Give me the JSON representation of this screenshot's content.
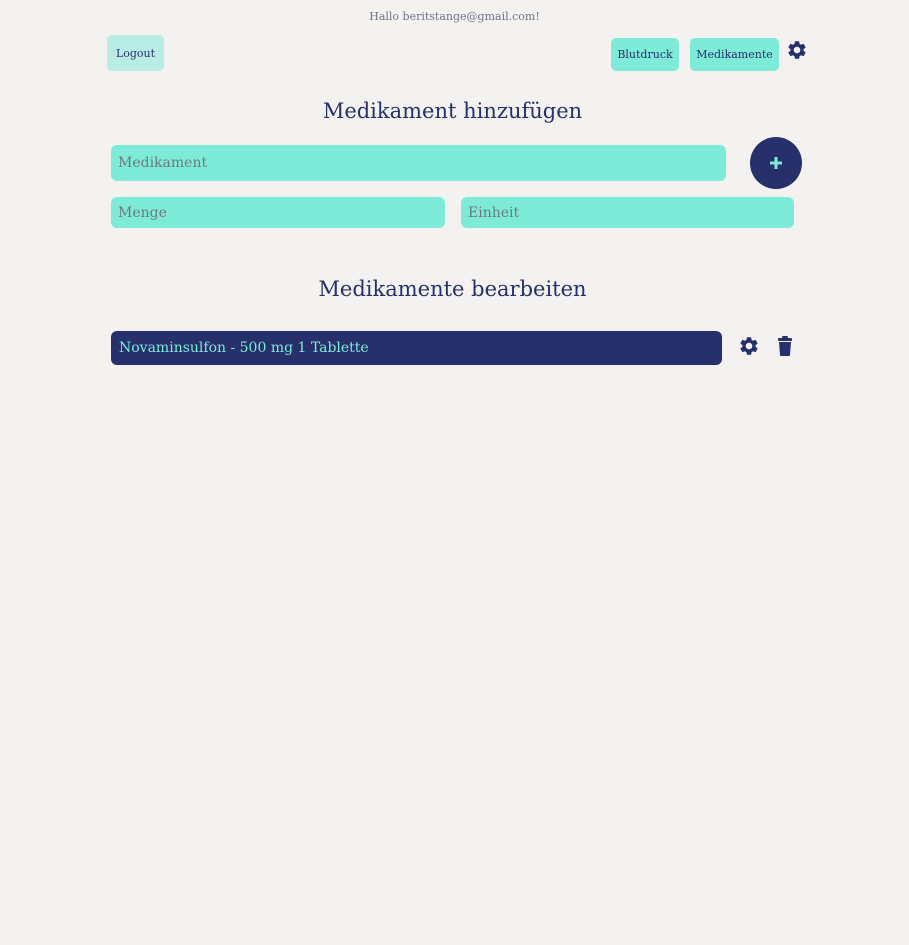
{
  "header": {
    "greeting": "Hallo beritstange@gmail.com!",
    "logout_label": "Logout",
    "nav": {
      "blutdruck_label": "Blutdruck",
      "medikamente_label": "Medikamente"
    },
    "settings_icon": "gear-icon"
  },
  "add_section": {
    "title": "Medikament hinzufügen",
    "medikament": {
      "value": "",
      "placeholder": "Medikament"
    },
    "menge": {
      "value": "",
      "placeholder": "Menge"
    },
    "einheit": {
      "value": "",
      "placeholder": "Einheit"
    },
    "add_icon": "plus-icon"
  },
  "edit_section": {
    "title": "Medikamente bearbeiten",
    "items": [
      {
        "label": "Novaminsulfon - 500 mg 1 Tablette",
        "settings_icon": "gear-icon",
        "delete_icon": "trash-icon"
      }
    ]
  },
  "colors": {
    "background": "#f4f2f1",
    "primary": "#27306a",
    "accent": "#7eebd9",
    "logout_bg": "#b8ece4"
  }
}
